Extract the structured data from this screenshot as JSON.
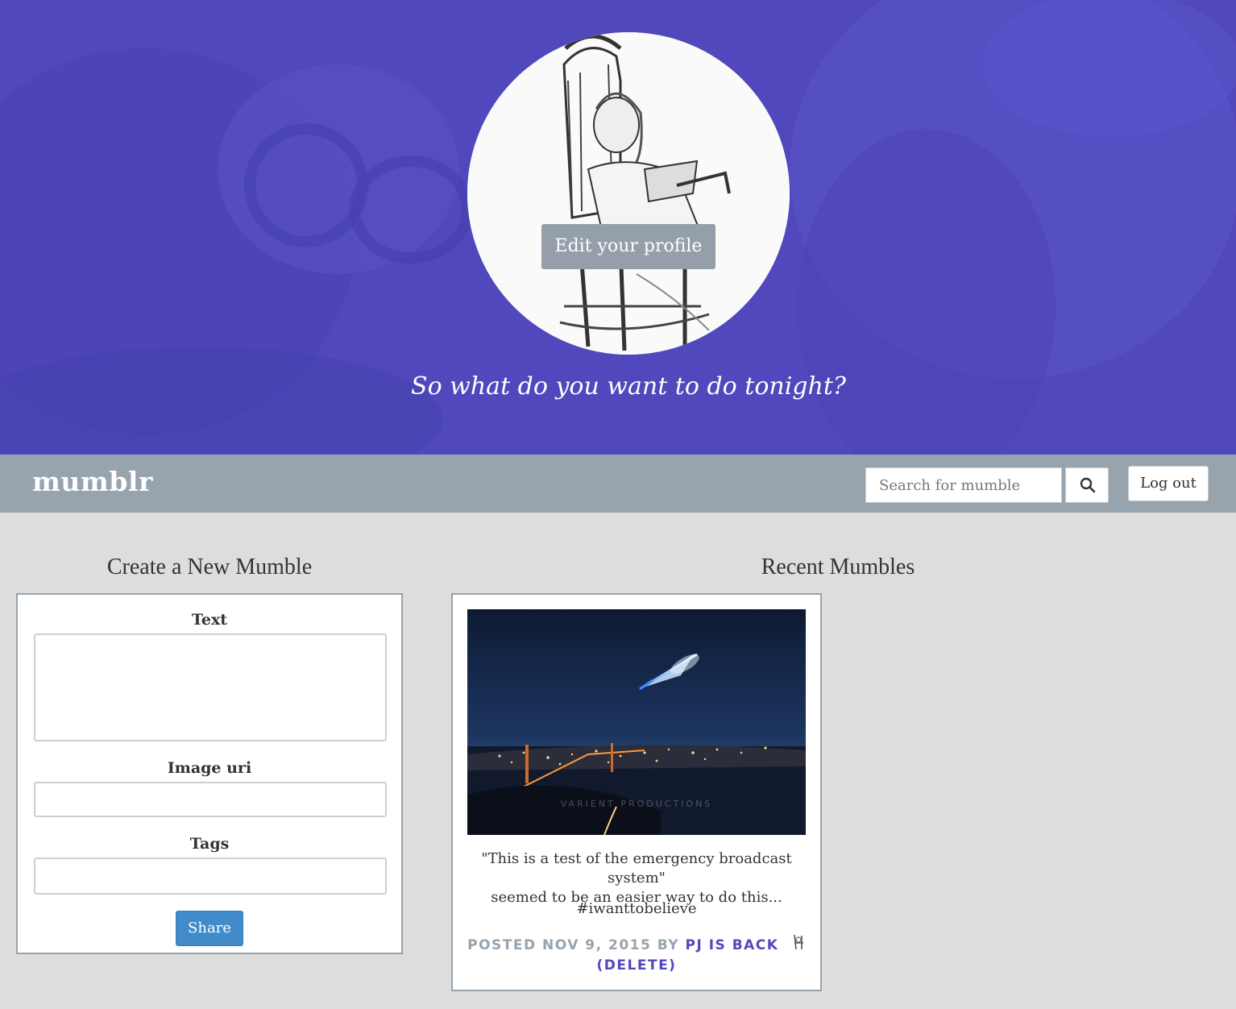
{
  "hero": {
    "edit_profile_label": "Edit your profile",
    "tagline": "So what do you want to do tonight?",
    "bg_color": "#5148bd"
  },
  "navbar": {
    "brand": "mumblr",
    "search_placeholder": "Search for mumble",
    "search_icon": "search-icon",
    "logout_label": "Log out",
    "bg_color": "#97a3ad"
  },
  "create": {
    "title": "Create a New Mumble",
    "text_label": "Text",
    "text_value": "",
    "image_label": "Image uri",
    "image_value": "",
    "tags_label": "Tags",
    "tags_value": "",
    "share_label": "Share",
    "share_color": "#428bca"
  },
  "recent": {
    "title": "Recent Mumbles",
    "mumbles": [
      {
        "image_watermark": "VARIENT PRODUCTIONS",
        "text_line1": "\"This is a test of the emergency broadcast system\"",
        "text_line2": "seemed to be an easier way to do this...",
        "tags": "#iwanttobelieve",
        "posted_prefix": "POSTED NOV 9, 2015 BY",
        "author": "PJ IS BACK",
        "delete_label": "(DELETE)"
      }
    ]
  }
}
